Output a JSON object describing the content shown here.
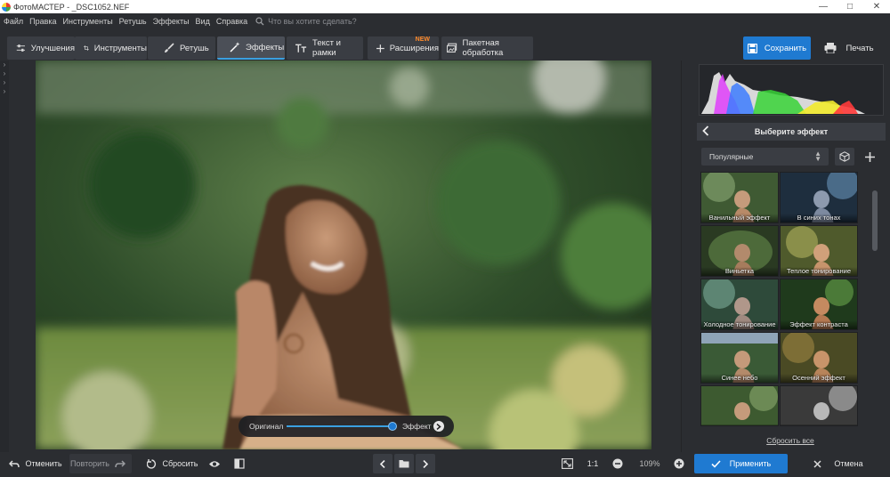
{
  "window": {
    "title": "ФотоМАСТЕР - _DSC1052.NEF"
  },
  "menu": {
    "items": [
      "Файл",
      "Правка",
      "Инструменты",
      "Ретушь",
      "Эффекты",
      "Вид",
      "Справка"
    ],
    "search_placeholder": "Что вы хотите сделать?"
  },
  "toolbar": {
    "tabs": [
      {
        "label": "Улучшения",
        "icon": "sliders-icon"
      },
      {
        "label": "Инструменты",
        "icon": "crop-icon"
      },
      {
        "label": "Ретушь",
        "icon": "brush-icon"
      },
      {
        "label": "Эффекты",
        "icon": "magic-wand-icon",
        "active": true
      },
      {
        "label": "Текст и рамки",
        "icon": "text-icon"
      },
      {
        "label": "Расширения",
        "icon": "plus-icon",
        "badge": "NEW"
      },
      {
        "label": "Пакетная обработка",
        "icon": "batch-icon"
      }
    ],
    "save_label": "Сохранить",
    "print_label": "Печать"
  },
  "compare_slider": {
    "left_label": "Оригинал",
    "right_label": "Эффект",
    "value": 1.0
  },
  "effects_panel": {
    "title": "Выберите эффект",
    "category": "Популярные",
    "effects": [
      "Ванильный эффект",
      "В синих тонах",
      "Виньетка",
      "Теплое тонирование",
      "Холодное тонирование",
      "Эффект контраста",
      "Синее небо",
      "Осенний эффект",
      "",
      ""
    ],
    "reset_all_label": "Сбросить все"
  },
  "bottom": {
    "undo_label": "Отменить",
    "redo_label": "Повторить",
    "reset_label": "Сбросить",
    "zoom_ratio_label": "1:1",
    "zoom_level": "109%",
    "apply_label": "Применить",
    "cancel_label": "Отмена"
  },
  "colors": {
    "accent": "#1f7ad1",
    "new_badge": "#ff8a2a",
    "background": "#2b2d31"
  }
}
